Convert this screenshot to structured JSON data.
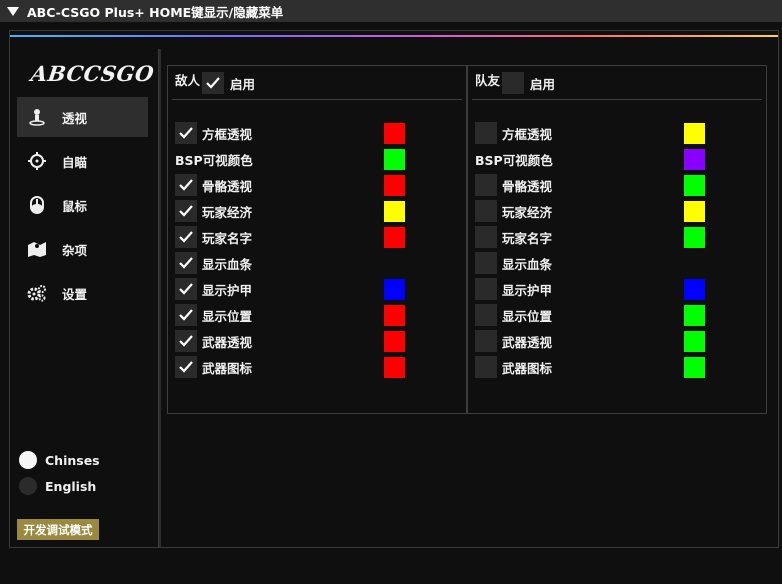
{
  "window": {
    "title": "ABC-CSGO Plus+ HOME键显示/隐藏菜单"
  },
  "sidebar": {
    "logo": "ABCCSGO",
    "items": [
      {
        "label": "透视",
        "icon": "person-icon",
        "active": true
      },
      {
        "label": "自瞄",
        "icon": "crosshair-icon",
        "active": false
      },
      {
        "label": "鼠标",
        "icon": "mouse-icon",
        "active": false
      },
      {
        "label": "杂项",
        "icon": "map-icon",
        "active": false
      },
      {
        "label": "设置",
        "icon": "gears-icon",
        "active": false
      }
    ],
    "languages": [
      {
        "label": "Chinses",
        "selected": true
      },
      {
        "label": "English",
        "selected": false
      }
    ],
    "dev_mode_label": "开发调试模式"
  },
  "enemy": {
    "title": "敌人",
    "enable_label": "启用",
    "enabled": true,
    "rows": [
      {
        "label": "方框透视",
        "checkbox": true,
        "checked": true,
        "color": "#ff0000"
      },
      {
        "label": "BSP可视颜色",
        "checkbox": false,
        "checked": false,
        "color": "#00ff00"
      },
      {
        "label": "骨骼透视",
        "checkbox": true,
        "checked": true,
        "color": "#ff0000"
      },
      {
        "label": "玩家经济",
        "checkbox": true,
        "checked": true,
        "color": "#ffff00"
      },
      {
        "label": "玩家名字",
        "checkbox": true,
        "checked": true,
        "color": "#ff0000"
      },
      {
        "label": "显示血条",
        "checkbox": true,
        "checked": true,
        "color": ""
      },
      {
        "label": "显示护甲",
        "checkbox": true,
        "checked": true,
        "color": "#0000ff"
      },
      {
        "label": "显示位置",
        "checkbox": true,
        "checked": true,
        "color": "#ff0000"
      },
      {
        "label": "武器透视",
        "checkbox": true,
        "checked": true,
        "color": "#ff0000"
      },
      {
        "label": "武器图标",
        "checkbox": true,
        "checked": true,
        "color": "#ff0000"
      }
    ]
  },
  "team": {
    "title": "队友",
    "enable_label": "启用",
    "enabled": false,
    "rows": [
      {
        "label": "方框透视",
        "checkbox": true,
        "checked": false,
        "color": "#ffff00"
      },
      {
        "label": "BSP可视颜色",
        "checkbox": false,
        "checked": false,
        "color": "#8800ff"
      },
      {
        "label": "骨骼透视",
        "checkbox": true,
        "checked": false,
        "color": "#00ff00"
      },
      {
        "label": "玩家经济",
        "checkbox": true,
        "checked": false,
        "color": "#ffff00"
      },
      {
        "label": "玩家名字",
        "checkbox": true,
        "checked": false,
        "color": "#00ff00"
      },
      {
        "label": "显示血条",
        "checkbox": true,
        "checked": false,
        "color": ""
      },
      {
        "label": "显示护甲",
        "checkbox": true,
        "checked": false,
        "color": "#0000ff"
      },
      {
        "label": "显示位置",
        "checkbox": true,
        "checked": false,
        "color": "#00ff00"
      },
      {
        "label": "武器透视",
        "checkbox": true,
        "checked": false,
        "color": "#00ff00"
      },
      {
        "label": "武器图标",
        "checkbox": true,
        "checked": false,
        "color": "#00ff00"
      }
    ]
  }
}
